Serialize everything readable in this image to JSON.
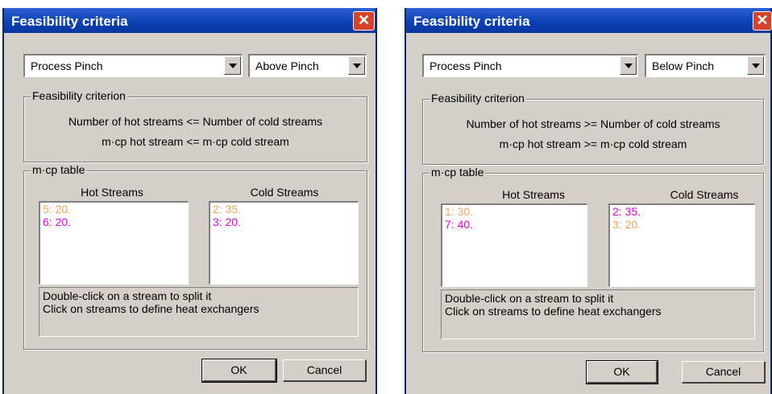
{
  "dialogs": [
    {
      "title": "Feasibility criteria",
      "close_glyph": "✕",
      "mode_select": "Process Pinch",
      "region_select": "Above Pinch",
      "criterion_group_label": "Feasibility criterion",
      "criterion_line1": "Number of hot streams <= Number of cold streams",
      "criterion_line2": "m·cp hot stream <= m·cp cold stream",
      "mcp_group_label": "m·cp table",
      "hot_header": "Hot Streams",
      "cold_header": "Cold Streams",
      "hot_streams": [
        {
          "text": "5: 20.",
          "color": "#f5a35a"
        },
        {
          "text": "6: 20.",
          "color": "#e800e8"
        }
      ],
      "cold_streams": [
        {
          "text": "2: 35.",
          "color": "#f5a35a"
        },
        {
          "text": "3: 20.",
          "color": "#e800e8"
        }
      ],
      "info_line1": "Double-click on a stream to split it",
      "info_line2": "Click on streams to define heat exchangers",
      "ok_label": "OK",
      "cancel_label": "Cancel"
    },
    {
      "title": "Feasibility criteria",
      "close_glyph": "✕",
      "mode_select": "Process Pinch",
      "region_select": "Below Pinch",
      "criterion_group_label": "Feasibility criterion",
      "criterion_line1": "Number of hot streams >= Number of cold streams",
      "criterion_line2": "m·cp hot stream >= m·cp cold stream",
      "mcp_group_label": "m·cp table",
      "hot_header": "Hot Streams",
      "cold_header": "Cold Streams",
      "hot_streams": [
        {
          "text": "1: 30.",
          "color": "#f5a35a"
        },
        {
          "text": "7: 40.",
          "color": "#e800e8"
        }
      ],
      "cold_streams": [
        {
          "text": "2: 35.",
          "color": "#e800e8"
        },
        {
          "text": "3: 20.",
          "color": "#f5a35a"
        }
      ],
      "info_line1": "Double-click on a stream to split it",
      "info_line2": "Click on streams to define heat exchangers",
      "ok_label": "OK",
      "cancel_label": "Cancel"
    }
  ]
}
